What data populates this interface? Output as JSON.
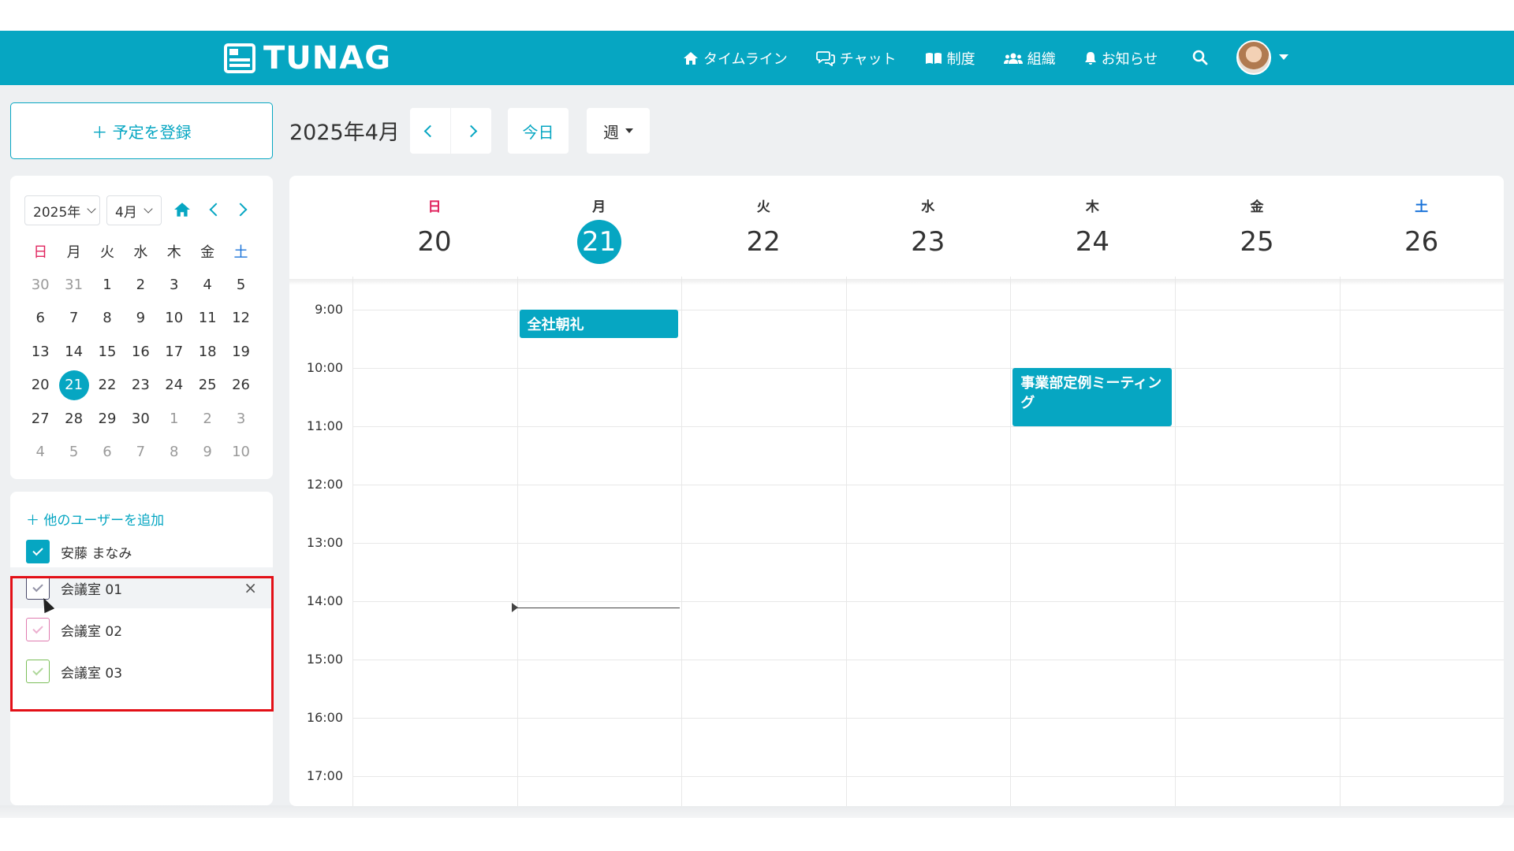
{
  "header": {
    "logo_text": "TUNAG",
    "nav": [
      {
        "label": "タイムライン",
        "icon": "home-icon"
      },
      {
        "label": "チャット",
        "icon": "chat-icon"
      },
      {
        "label": "制度",
        "icon": "book-icon"
      },
      {
        "label": "組織",
        "icon": "users-icon"
      },
      {
        "label": "お知らせ",
        "icon": "bell-icon"
      }
    ]
  },
  "sidebar": {
    "add_event_label": "＋ 予定を登録",
    "mini_calendar": {
      "year_select": "2025年",
      "month_select": "4月",
      "weekdays": [
        "日",
        "月",
        "火",
        "水",
        "木",
        "金",
        "土"
      ],
      "weeks": [
        [
          "30",
          "31",
          "1",
          "2",
          "3",
          "4",
          "5"
        ],
        [
          "6",
          "7",
          "8",
          "9",
          "10",
          "11",
          "12"
        ],
        [
          "13",
          "14",
          "15",
          "16",
          "17",
          "18",
          "19"
        ],
        [
          "20",
          "21",
          "22",
          "23",
          "24",
          "25",
          "26"
        ],
        [
          "27",
          "28",
          "29",
          "30",
          "1",
          "2",
          "3"
        ],
        [
          "4",
          "5",
          "6",
          "7",
          "8",
          "9",
          "10"
        ]
      ],
      "today": "21"
    },
    "add_user_label": "＋ 他のユーザーを追加",
    "users": [
      {
        "name": "安藤 まなみ",
        "checked": true,
        "color": "#06a6c2"
      },
      {
        "name": "会議室 01",
        "checked": false,
        "color": "#4a4a6a"
      },
      {
        "name": "会議室 02",
        "checked": false,
        "color": "#e07cb0"
      },
      {
        "name": "会議室 03",
        "checked": false,
        "color": "#7cbf5a"
      }
    ],
    "remove_symbol": "×"
  },
  "toolbar": {
    "month_title": "2025年4月",
    "today_label": "今日",
    "view_label": "週"
  },
  "week": {
    "days": [
      {
        "dow": "日",
        "num": "20",
        "color": "#e0245e"
      },
      {
        "dow": "月",
        "num": "21",
        "today": true,
        "color": "#333333"
      },
      {
        "dow": "火",
        "num": "22",
        "color": "#333333"
      },
      {
        "dow": "水",
        "num": "23",
        "color": "#333333"
      },
      {
        "dow": "木",
        "num": "24",
        "color": "#333333"
      },
      {
        "dow": "金",
        "num": "25",
        "color": "#333333"
      },
      {
        "dow": "土",
        "num": "26",
        "color": "#1a73d9"
      }
    ],
    "times": [
      "9:00",
      "10:00",
      "11:00",
      "12:00",
      "13:00",
      "14:00",
      "15:00",
      "16:00",
      "17:00"
    ],
    "events": [
      {
        "title": "全社朝礼",
        "day": "21",
        "start": "9:00"
      },
      {
        "title": "事業部定例ミーティング",
        "day": "24",
        "start": "10:00",
        "end": "11:00"
      }
    ]
  },
  "colors": {
    "accent": "#06a6c2",
    "highlight": "#e31017"
  }
}
